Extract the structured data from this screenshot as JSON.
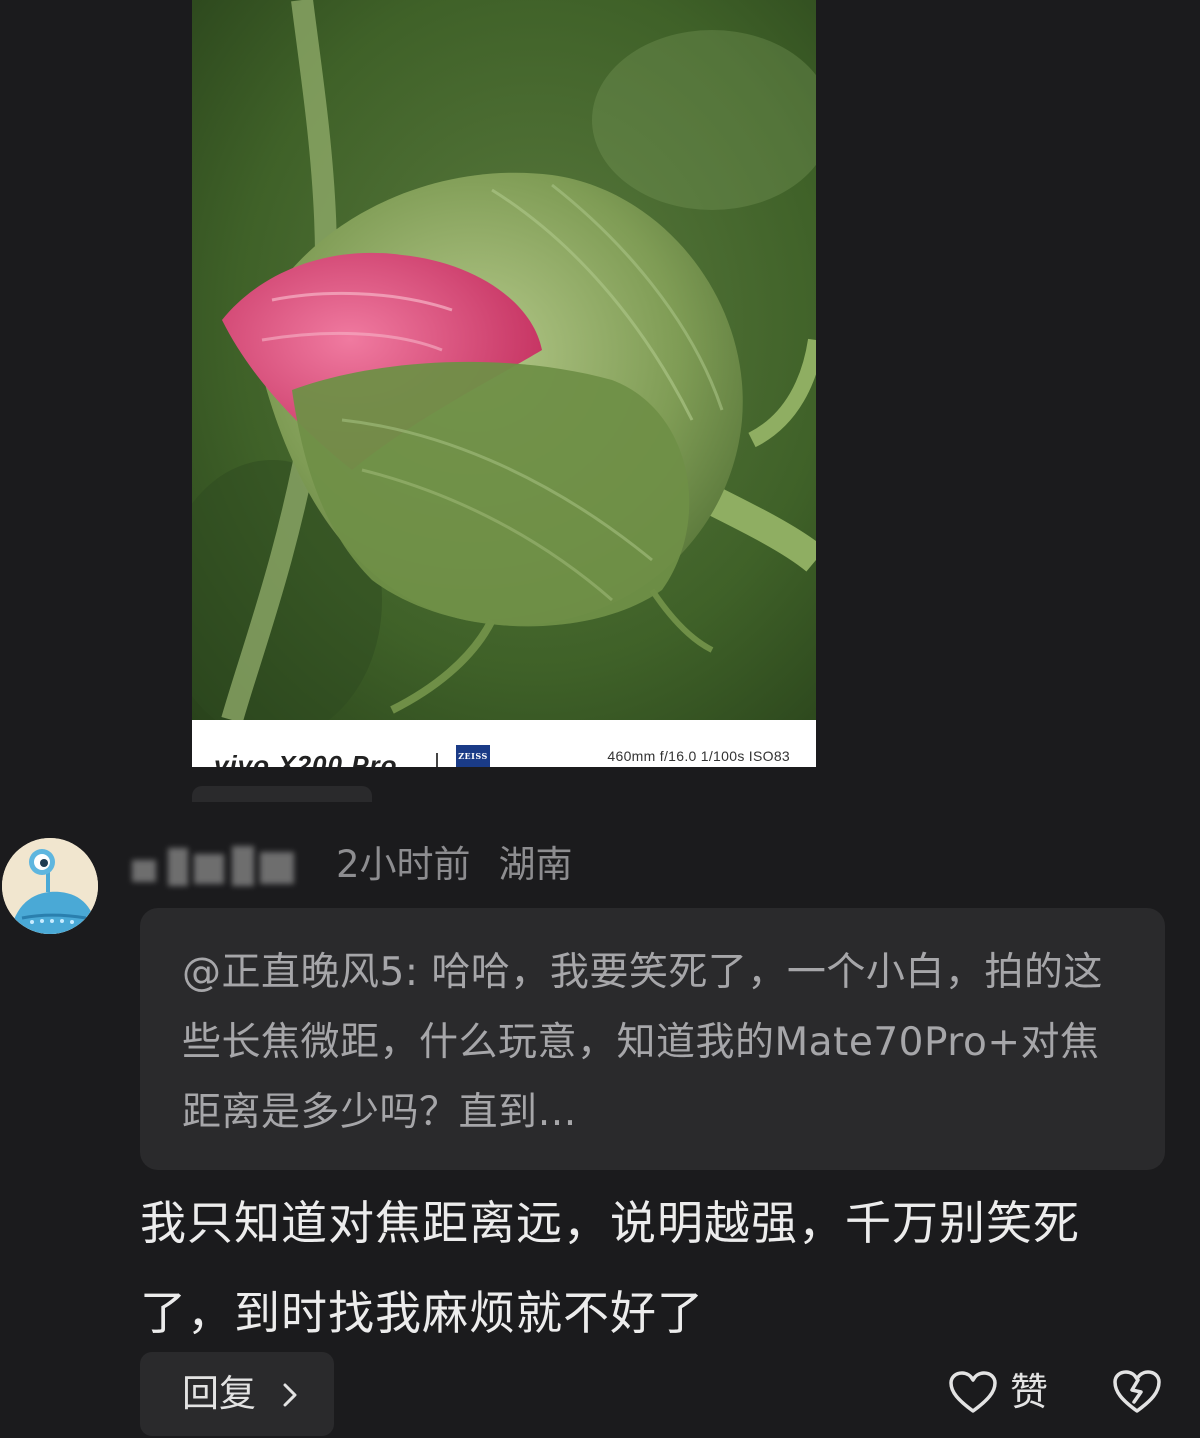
{
  "post_image": {
    "brand_text": "vivo X200 Pro",
    "partner_logo_text": "ZEISS",
    "exif": "460mm  f/16.0  1/100s  ISO83",
    "icon": "flower-bud-photo"
  },
  "comment": {
    "avatar_icon": "cartoon-alien-avatar",
    "time": "2小时前",
    "location": "湖南",
    "quoted_text": "@正直晚风5: 哈哈，我要笑死了，一个小白，拍的这些长焦微距，什么玩意，知道我的Mate70Pro+对焦距离是多少吗？直到…",
    "body": "我只知道对焦距离远，说明越强，千万别笑死了，到时找我麻烦就不好了",
    "reply_label": "回复",
    "like_label": "赞"
  },
  "colors": {
    "background": "#1b1b1d",
    "card": "#2a2a2c",
    "meta_text": "#8d8d90",
    "quote_text": "#a6a6a9"
  }
}
